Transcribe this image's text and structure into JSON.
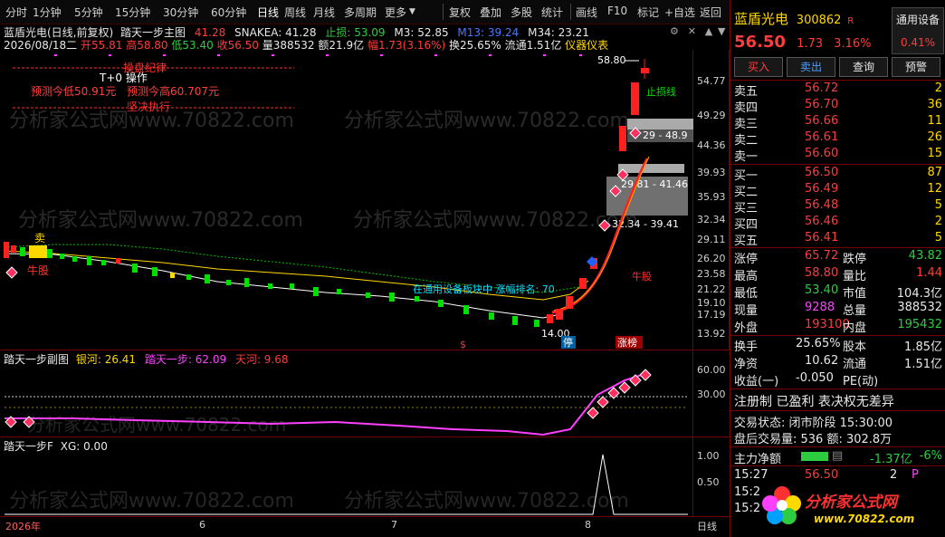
{
  "toolbar": {
    "items": [
      "分时",
      "1分钟",
      "5分钟",
      "15分钟",
      "30分钟",
      "60分钟",
      "日线",
      "周线",
      "月线",
      "多周期",
      "更多"
    ],
    "right_items": [
      "复权",
      "叠加",
      "多股",
      "统计",
      "画线",
      "F10",
      "标记",
      "+自选",
      "返回"
    ]
  },
  "header": {
    "title": "蓝盾光电(日线,前复权)",
    "indicator_name": "踏天一步主图",
    "ind_val1": "41.28",
    "snakea": "SNAKEA: 41.28",
    "stop_profit": "止损: 53.09",
    "m3": "M3: 52.85",
    "m13": "M13: 39.24",
    "m34": "M34: 23.21",
    "date": "2026/08/18二",
    "open": "开55.81",
    "high": "高58.80",
    "low": "低53.40",
    "close": "收56.50",
    "vol": "量388532",
    "amount": "额21.9亿",
    "change": "幅1.73(3.16%)",
    "turnover": "换25.65%",
    "float": "流通1.51亿",
    "gauge": "仪器仪表"
  },
  "main_chart": {
    "y_ticks": [
      "54.77",
      "49.29",
      "44.36",
      "39.93",
      "35.93",
      "32.34",
      "29.11",
      "26.20",
      "23.58",
      "21.22",
      "19.10",
      "17.19",
      "13.92"
    ],
    "discipline_title": "操盘纪律",
    "t0_label": "T+0 操作",
    "pred_low": "预测今低50.91元",
    "pred_high": "预测今高60.707元",
    "execute_label": "坚决执行",
    "sell_label": "卖",
    "bull_label": "牛股",
    "sector_label": "在通用设备板块中  涨幅排名: 70",
    "stop_line_label": "止损线",
    "sell_stock_label": "牛股",
    "zone1": "29 - 48.9",
    "zone2": "29.81 - 41.46",
    "zone3": "32.34 - 39.41",
    "high_mark": "58.80",
    "low_mark": "14.00",
    "stop_mark": "停",
    "limit_mark": "涨榜",
    "dollar_mark": "$",
    "watermark": "分析家公式网www.70822.com"
  },
  "sub1": {
    "name": "踏天一步副图",
    "silver": "银河: 26.41",
    "step": "踏天一步: 62.09",
    "tianhe": "天河: 9.68",
    "ticks": [
      "60.00",
      "30.00"
    ]
  },
  "sub2": {
    "name": "踏天一步F",
    "xg": "XG: 0.00",
    "ticks": [
      "1.00",
      "0.50"
    ]
  },
  "x_axis": {
    "labels": [
      "2026年",
      "6",
      "7",
      "8"
    ],
    "period": "日线"
  },
  "right_panel": {
    "name": "蓝盾光电",
    "code": "300862",
    "flag": "R",
    "tag": "通用设备",
    "price": "56.50",
    "chg": "1.73",
    "pct": "3.16%",
    "tag_pct": "0.41%",
    "buttons": [
      "买入",
      "卖出",
      "查询",
      "预警"
    ],
    "asks": [
      {
        "label": "卖五",
        "price": "56.72",
        "vol": "2"
      },
      {
        "label": "卖四",
        "price": "56.70",
        "vol": "36"
      },
      {
        "label": "卖三",
        "price": "56.66",
        "vol": "11"
      },
      {
        "label": "卖二",
        "price": "56.61",
        "vol": "26"
      },
      {
        "label": "卖一",
        "price": "56.60",
        "vol": "15"
      }
    ],
    "bids": [
      {
        "label": "买一",
        "price": "56.50",
        "vol": "87"
      },
      {
        "label": "买二",
        "price": "56.49",
        "vol": "12"
      },
      {
        "label": "买三",
        "price": "56.48",
        "vol": "5"
      },
      {
        "label": "买四",
        "price": "56.46",
        "vol": "2"
      },
      {
        "label": "买五",
        "price": "56.41",
        "vol": "5"
      }
    ],
    "stats": [
      {
        "l1": "涨停",
        "v1": "65.72",
        "l2": "跌停",
        "v2": "43.82"
      },
      {
        "l1": "最高",
        "v1": "58.80",
        "l2": "量比",
        "v2": "1.44"
      },
      {
        "l1": "最低",
        "v1": "53.40",
        "l2": "市值",
        "v2": "104.3亿"
      },
      {
        "l1": "现量",
        "v1": "9288",
        "l2": "总量",
        "v2": "388532"
      },
      {
        "l1": "外盘",
        "v1": "193100",
        "l2": "内盘",
        "v2": "195432"
      }
    ],
    "stats2": [
      {
        "l1": "换手",
        "v1": "25.65%",
        "l2": "股本",
        "v2": "1.85亿"
      },
      {
        "l1": "净资",
        "v1": "10.62",
        "l2": "流通",
        "v2": "1.51亿"
      },
      {
        "l1": "收益(一)",
        "v1": "-0.050",
        "l2": "PE(动)",
        "v2": ""
      }
    ],
    "reg": "注册制 已盈利 表决权无差异",
    "trade_state": "交易状态: 闭市阶段 15:30:00",
    "after_vol": "盘后交易量: 536  额: 302.8万",
    "main_flow_label": "主力净额",
    "main_flow": "-1.37亿",
    "main_pct": "-6%",
    "tick_time": "15:27",
    "tick_price": "56.50",
    "tick_vol": "2",
    "tick_flag": "P",
    "tick_rows": [
      "15:2",
      "15:2"
    ],
    "logo_text": "分析家公式网",
    "logo_url": "www.70822.com"
  }
}
